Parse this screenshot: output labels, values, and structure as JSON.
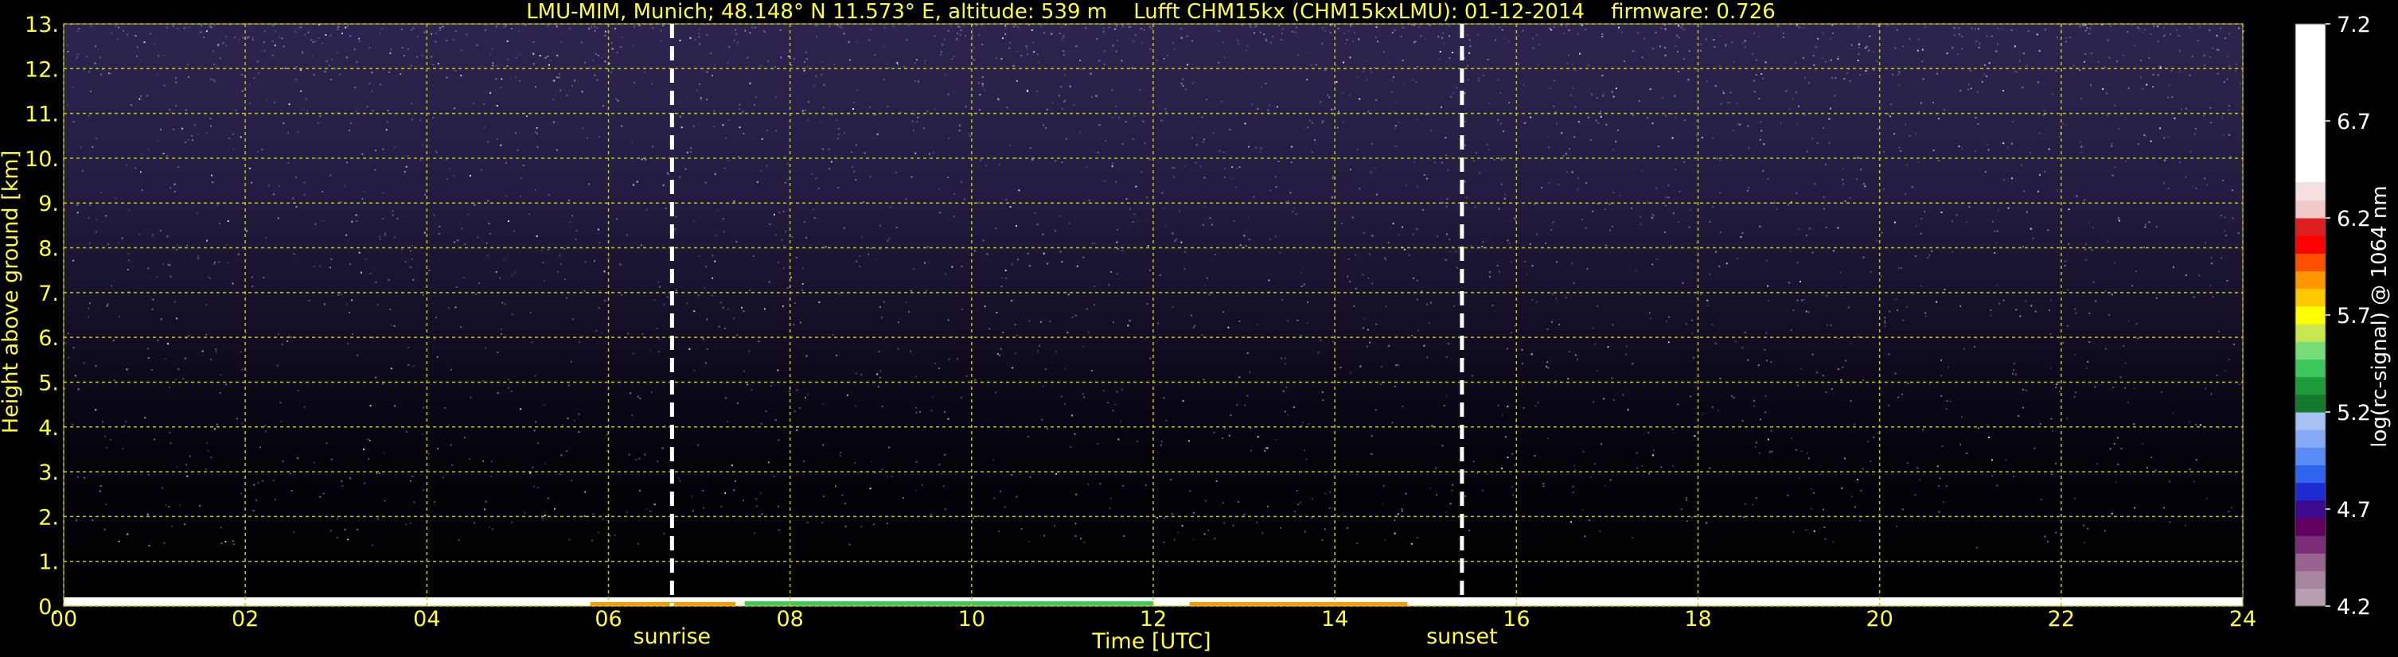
{
  "chart_data": {
    "type": "heatmap",
    "title": "LMU-MIM, Munich; 48.148° N 11.573° E, altitude: 539 m    Lufft CHM15kx (CHM15kxLMU): 01-12-2014    firmware: 0.726",
    "xlabel": "Time [UTC]",
    "ylabel": "Height above ground [km]",
    "xlim": [
      0,
      24
    ],
    "ylim": [
      0,
      13
    ],
    "x_ticks": [
      "00",
      "02",
      "04",
      "06",
      "08",
      "10",
      "12",
      "14",
      "16",
      "18",
      "20",
      "22",
      "24"
    ],
    "y_ticks": [
      "0.",
      "1.",
      "2.",
      "3.",
      "4.",
      "5.",
      "6.",
      "7.",
      "8.",
      "9.",
      "10.",
      "11.",
      "12.",
      "13."
    ],
    "grid": true,
    "markers": [
      {
        "label": "sunrise",
        "time": 6.7
      },
      {
        "label": "sunset",
        "time": 15.4
      }
    ],
    "colorbar": {
      "label": "log(rc-signal) @ 1064 nm",
      "range": [
        4.2,
        7.2
      ],
      "ticks": [
        "4.2",
        "4.7",
        "5.2",
        "5.7",
        "6.2",
        "6.7",
        "7.2"
      ],
      "colors": [
        "#b7a0b2",
        "#a886a0",
        "#98648f",
        "#7a2e78",
        "#620062",
        "#3c0a8c",
        "#1e2ad2",
        "#2e64f0",
        "#5a8cf5",
        "#86aaf5",
        "#a6c2f5",
        "#14782e",
        "#1e9c3c",
        "#3cc85a",
        "#78dc78",
        "#c8e650",
        "#ffff00",
        "#ffc800",
        "#ff9600",
        "#ff5000",
        "#ff0000",
        "#dc1e1e",
        "#f0c8c8",
        "#f5e1e1",
        "#ffffff"
      ]
    }
  }
}
